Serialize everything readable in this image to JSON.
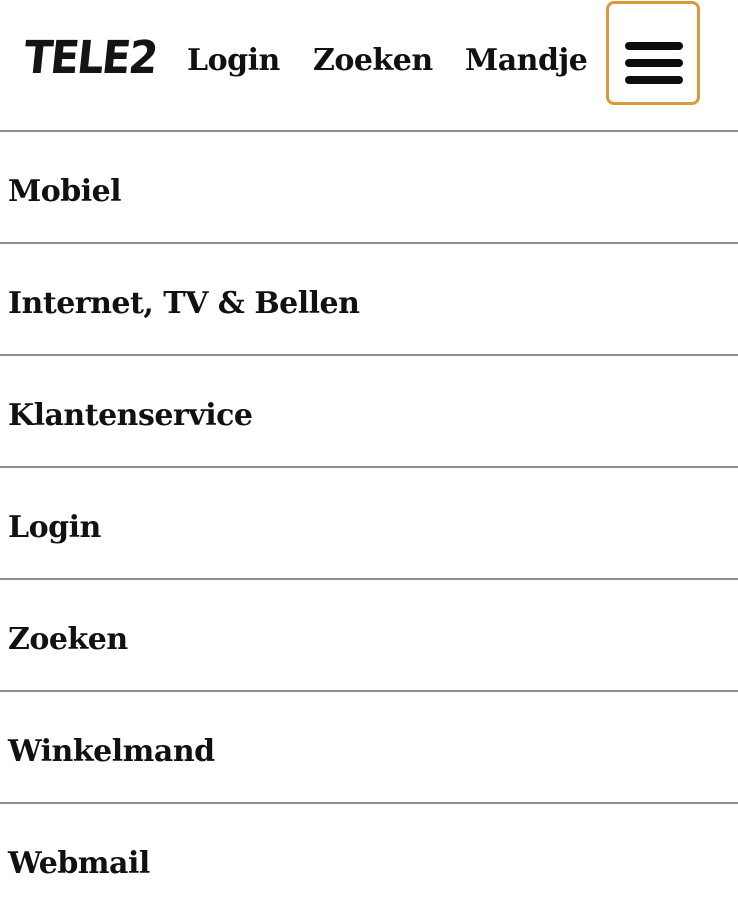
{
  "header": {
    "logo_text": "TELE2",
    "links": {
      "login": "Login",
      "search": "Zoeken",
      "cart": "Mandje"
    },
    "menu_button_icon": "hamburger-menu-icon",
    "menu_button_focus_color": "#d89a3a"
  },
  "menu": {
    "items": [
      {
        "label": "Mobiel"
      },
      {
        "label": "Internet, TV & Bellen"
      },
      {
        "label": "Klantenservice"
      },
      {
        "label": "Login"
      },
      {
        "label": "Zoeken"
      },
      {
        "label": "Winkelmand"
      },
      {
        "label": "Webmail"
      }
    ]
  }
}
